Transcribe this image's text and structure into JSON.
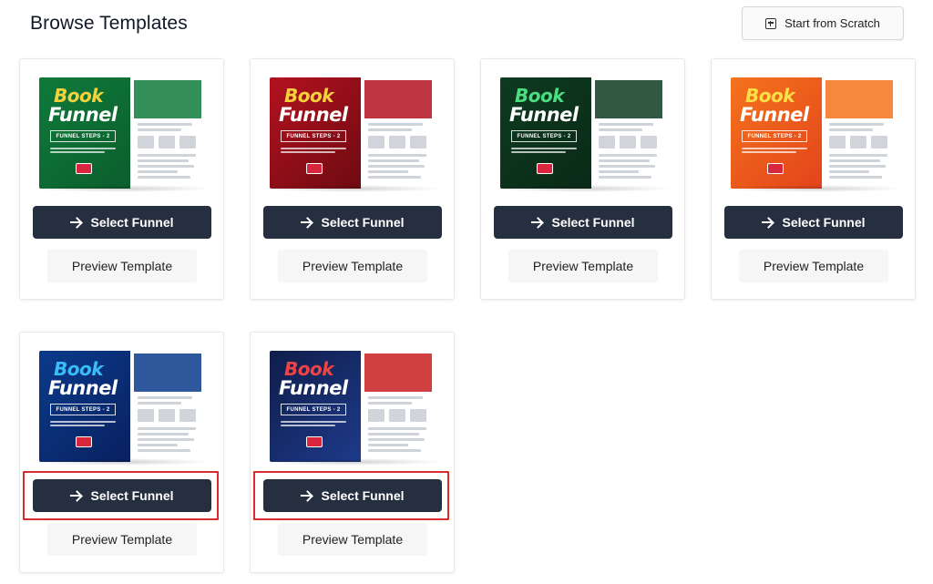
{
  "header": {
    "title": "Browse Templates",
    "scratch_label": "Start from Scratch"
  },
  "templates": [
    {
      "book": "Book",
      "funnel": "Funnel",
      "steps": "FUNNEL STEPS - 2",
      "theme": "green",
      "left_bg": "linear-gradient(135deg,#0f7a3a,#0b5e2c)",
      "book_color": "#f5d23b",
      "select_label": "Select Funnel",
      "preview_label": "Preview Template",
      "highlighted": false
    },
    {
      "book": "Book",
      "funnel": "Funnel",
      "steps": "FUNNEL STEPS - 2",
      "theme": "red",
      "left_bg": "linear-gradient(135deg,#b3121f,#6e0a12)",
      "book_color": "#f5d23b",
      "select_label": "Select Funnel",
      "preview_label": "Preview Template",
      "highlighted": false
    },
    {
      "book": "Book",
      "funnel": "Funnel",
      "steps": "FUNNEL STEPS - 2",
      "theme": "dark-green",
      "left_bg": "linear-gradient(135deg,#0d3b20,#0a2a17)",
      "book_color": "#4ade80",
      "select_label": "Select Funnel",
      "preview_label": "Preview Template",
      "highlighted": false
    },
    {
      "book": "Book",
      "funnel": "Funnel",
      "steps": "FUNNEL STEPS - 2",
      "theme": "orange",
      "left_bg": "linear-gradient(135deg,#f5731c,#e2441b)",
      "book_color": "#fde047",
      "select_label": "Select Funnel",
      "preview_label": "Preview Template",
      "highlighted": false
    },
    {
      "book": "Book",
      "funnel": "Funnel",
      "steps": "FUNNEL STEPS - 2",
      "theme": "blue",
      "left_bg": "linear-gradient(135deg,#0b3a8a,#0a2160)",
      "book_color": "#38bdf8",
      "select_label": "Select Funnel",
      "preview_label": "Preview Template",
      "highlighted": true
    },
    {
      "book": "Book",
      "funnel": "Funnel",
      "steps": "FUNNEL STEPS - 2",
      "theme": "navy-red",
      "left_bg": "linear-gradient(135deg,#0f1d4a,#1e3a8a)",
      "book_color": "#ef4444",
      "select_label": "Select Funnel",
      "preview_label": "Preview Template",
      "highlighted": true
    }
  ],
  "colors": {
    "button_dark": "#252f3f",
    "highlight": "#d92b2b"
  },
  "icons": {
    "scratch": "plus-square-icon",
    "select": "arrow-right-icon"
  }
}
